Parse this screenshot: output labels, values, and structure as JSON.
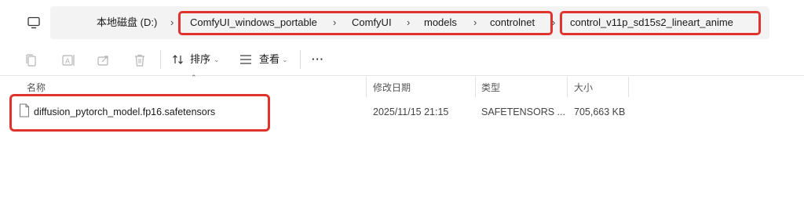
{
  "address_bar": {
    "drive": "本地磁盘 (D:)",
    "path_highlighted": [
      "ComfyUI_windows_portable",
      "ComfyUI",
      "models",
      "controlnet"
    ],
    "current_folder": "control_v11p_sd15s2_lineart_anime",
    "more_glyph": "···"
  },
  "toolbar": {
    "sort_label": "排序",
    "view_label": "查看",
    "more_glyph": "···"
  },
  "columns": {
    "name": "名称",
    "modified": "修改日期",
    "type": "类型",
    "size": "大小"
  },
  "files": [
    {
      "name": "diffusion_pytorch_model.fp16.safetensors",
      "modified": "2025/11/15 21:15",
      "type": "SAFETENSORS ...",
      "size": "705,663 KB"
    }
  ],
  "colors": {
    "highlight": "#e0332e",
    "address_bg": "#f3f3f3",
    "disabled_icon": "#b4b4b4"
  }
}
